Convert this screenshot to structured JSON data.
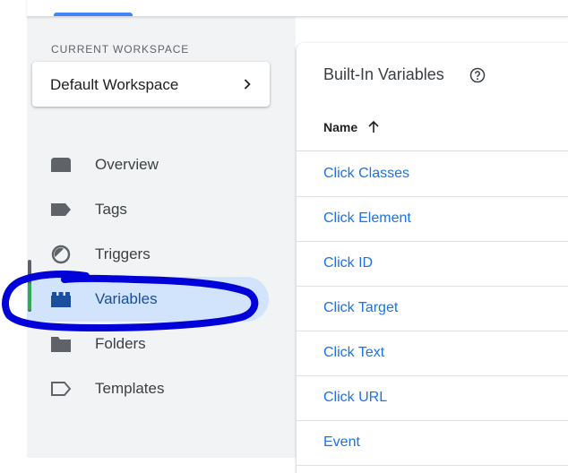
{
  "workspace": {
    "section_label": "CURRENT WORKSPACE",
    "name": "Default Workspace",
    "chevron_icon": "chevron-right-icon"
  },
  "nav": {
    "items": [
      {
        "label": "Overview",
        "icon": "overview-icon"
      },
      {
        "label": "Tags",
        "icon": "tag-icon"
      },
      {
        "label": "Triggers",
        "icon": "trigger-icon"
      },
      {
        "label": "Variables",
        "icon": "variables-icon",
        "active": true
      },
      {
        "label": "Folders",
        "icon": "folder-icon"
      },
      {
        "label": "Templates",
        "icon": "template-icon"
      }
    ]
  },
  "builtin": {
    "title": "Built-In Variables",
    "help_icon": "help-icon",
    "column_header": "Name",
    "sort_icon": "arrow-up-icon",
    "rows": [
      "Click Classes",
      "Click Element",
      "Click ID",
      "Click Target",
      "Click Text",
      "Click URL",
      "Event"
    ]
  },
  "colors": {
    "accent": "#1a73e8",
    "active_bg": "#d2e3fc",
    "annotation": "#0000d8"
  }
}
